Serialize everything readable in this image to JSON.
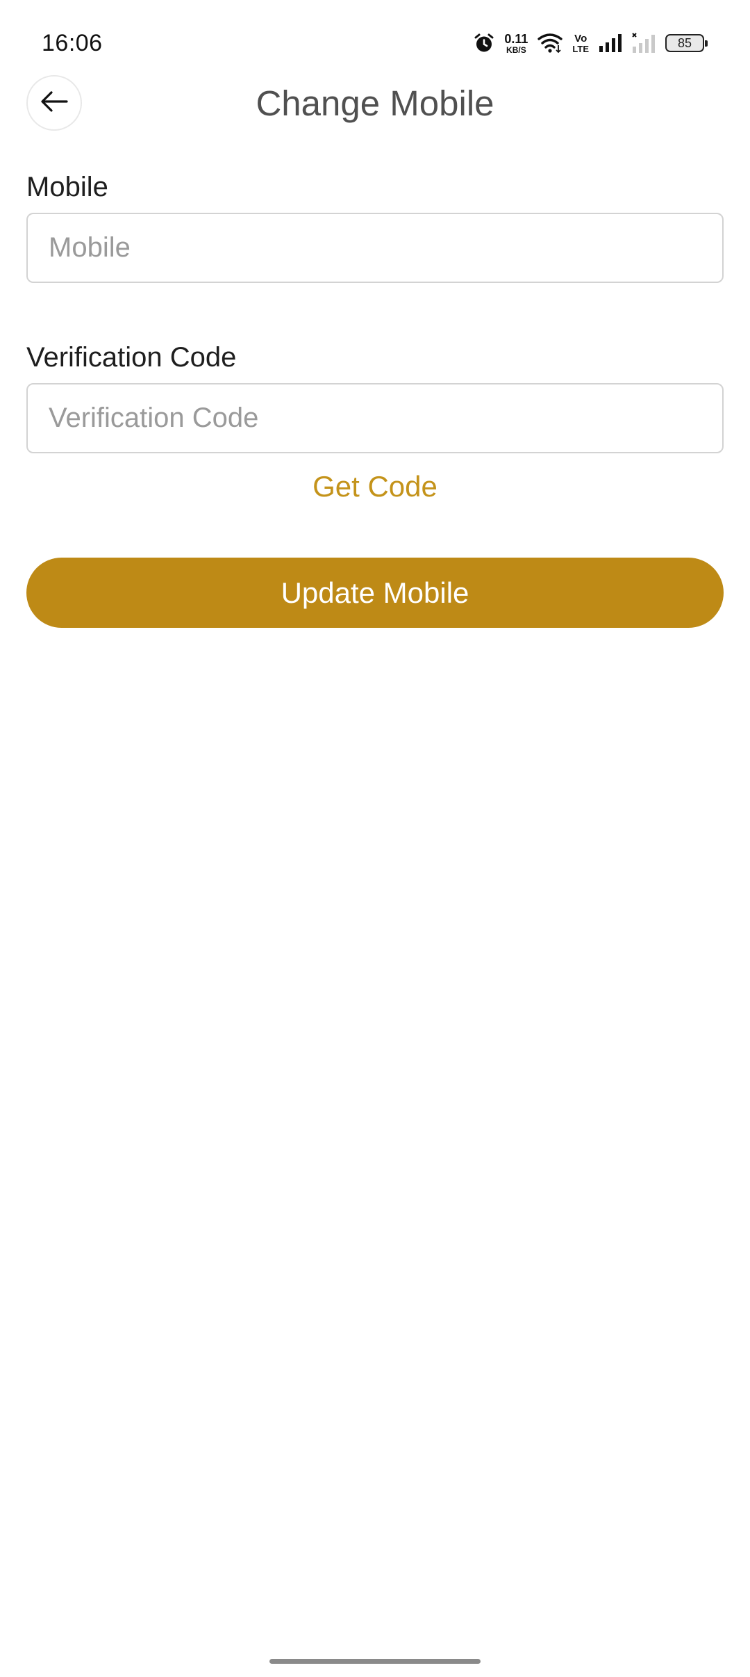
{
  "status_bar": {
    "time": "16:06",
    "net_speed_value": "0.11",
    "net_speed_unit": "KB/S",
    "volte_top": "Vo",
    "volte_bottom": "LTE",
    "battery_level": "85",
    "icons": [
      "alarm-icon",
      "wifi-icon",
      "volte-icon",
      "signal-icon",
      "signal-no-service-icon",
      "battery-icon"
    ]
  },
  "header": {
    "back_icon": "arrow-left-icon",
    "title": "Change Mobile"
  },
  "form": {
    "mobile": {
      "label": "Mobile",
      "placeholder": "Mobile",
      "value": ""
    },
    "verification_code": {
      "label": "Verification Code",
      "placeholder": "Verification Code",
      "value": ""
    },
    "get_code_label": "Get Code",
    "submit_label": "Update Mobile"
  },
  "colors": {
    "accent": "#be8a16",
    "link": "#c4931a",
    "title_text": "#505050",
    "input_border": "#d3d3d3",
    "placeholder": "#9a9a9a"
  }
}
